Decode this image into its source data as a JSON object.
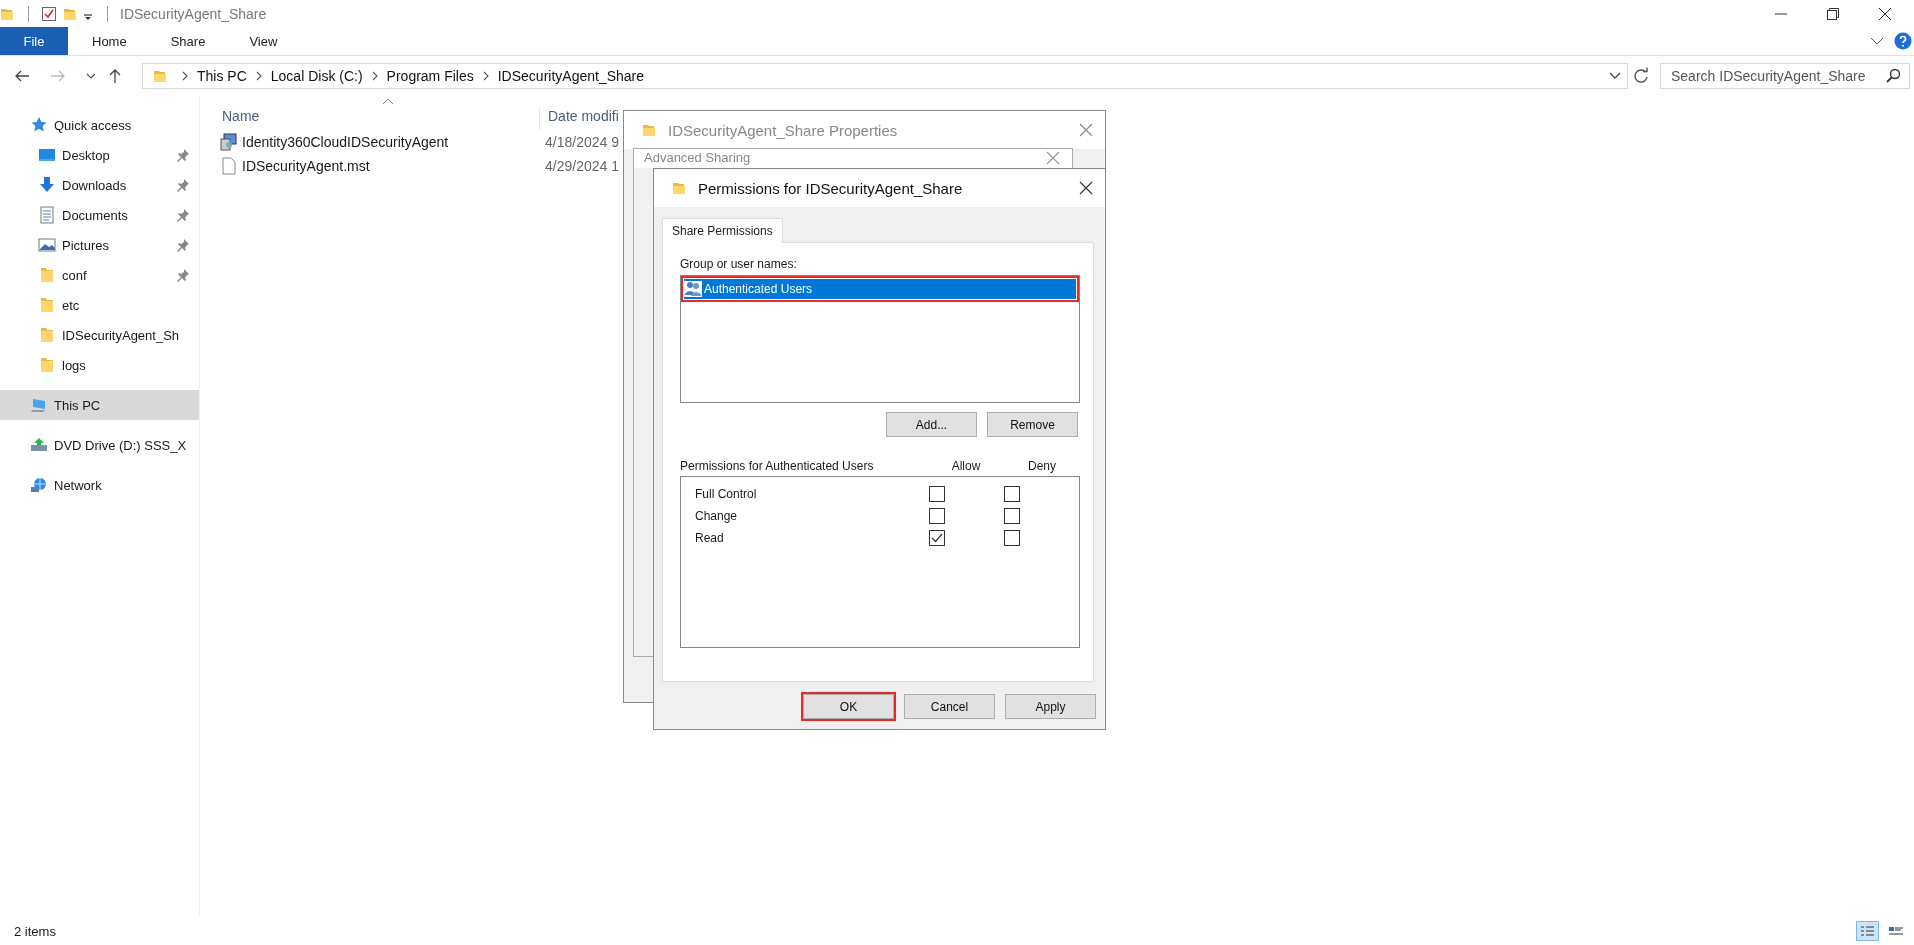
{
  "window": {
    "title": "IDSecurityAgent_Share"
  },
  "ribbon": {
    "tabs": [
      {
        "label": "File",
        "kind": "file"
      },
      {
        "label": "Home",
        "kind": "tab"
      },
      {
        "label": "Share",
        "kind": "tab"
      },
      {
        "label": "View",
        "kind": "tab"
      }
    ]
  },
  "address_bar": {
    "path": [
      "This PC",
      "Local Disk (C:)",
      "Program Files",
      "IDSecurityAgent_Share"
    ]
  },
  "search": {
    "placeholder": "Search IDSecurityAgent_Share"
  },
  "sidebar": {
    "items": [
      {
        "label": "Quick access",
        "kind": "star",
        "pinned": false,
        "selected": false,
        "children": [
          {
            "label": "Desktop",
            "kind": "desktop",
            "pinned": true,
            "selected": false
          },
          {
            "label": "Downloads",
            "kind": "downloads",
            "pinned": true,
            "selected": false
          },
          {
            "label": "Documents",
            "kind": "documents",
            "pinned": true,
            "selected": false
          },
          {
            "label": "Pictures",
            "kind": "pictures",
            "pinned": true,
            "selected": false
          },
          {
            "label": "conf",
            "kind": "folder",
            "pinned": true,
            "selected": false
          },
          {
            "label": "etc",
            "kind": "folder",
            "pinned": false,
            "selected": false
          },
          {
            "label": "IDSecurityAgent_Sh",
            "kind": "folder",
            "pinned": false,
            "selected": false
          },
          {
            "label": "logs",
            "kind": "folder",
            "pinned": false,
            "selected": false
          }
        ]
      },
      {
        "label": "This PC",
        "kind": "pc",
        "pinned": false,
        "selected": true
      },
      {
        "label": "DVD Drive (D:) SSS_X",
        "kind": "dvd",
        "pinned": false,
        "selected": false
      },
      {
        "label": "Network",
        "kind": "network",
        "pinned": false,
        "selected": false
      }
    ]
  },
  "file_list": {
    "columns": [
      "Name",
      "Date modifi"
    ],
    "rows": [
      {
        "name": "Identity360CloudIDSecurityAgent",
        "date": "4/18/2024 9",
        "kind": "installer"
      },
      {
        "name": "IDSecurityAgent.mst",
        "date": "4/29/2024 1",
        "kind": "file"
      }
    ]
  },
  "dialogs": {
    "properties": {
      "title": "IDSecurityAgent_Share Properties"
    },
    "advanced_sharing": {
      "title": "Advanced Sharing"
    },
    "permissions": {
      "title": "Permissions for IDSecurityAgent_Share",
      "tabs": [
        {
          "label": "Share Permissions",
          "selected": true
        }
      ],
      "group_label": "Group or user names:",
      "users": [
        {
          "name": "Authenticated Users",
          "selected": true,
          "highlighted": true
        }
      ],
      "user_buttons": [
        "Add...",
        "Remove"
      ],
      "permissions_label": "Permissions for Authenticated Users",
      "columns": [
        "Allow",
        "Deny"
      ],
      "permissions": [
        {
          "name": "Full Control",
          "allow": false,
          "deny": false
        },
        {
          "name": "Change",
          "allow": false,
          "deny": false
        },
        {
          "name": "Read",
          "allow": true,
          "deny": false
        }
      ],
      "footer_buttons": [
        {
          "label": "OK",
          "highlighted": true
        },
        {
          "label": "Cancel",
          "highlighted": false
        },
        {
          "label": "Apply",
          "highlighted": false
        }
      ]
    }
  },
  "status_bar": {
    "item_count": "2 items",
    "views": [
      {
        "kind": "details",
        "selected": true
      },
      {
        "kind": "tiles",
        "selected": false
      }
    ]
  }
}
